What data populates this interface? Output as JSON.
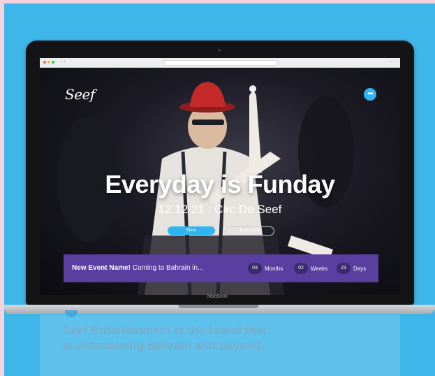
{
  "browser": {
    "controls": [
      "close-dot",
      "minimize-dot",
      "maximize-dot"
    ],
    "nav": "‹ ›",
    "tools": "⋯"
  },
  "site": {
    "logo": "Seef",
    "menu_icon": "•••",
    "hero_title": "Everyday is Funday",
    "hero_subtitle": "12.12.21 : Circ De Seef",
    "more_button": "More",
    "book_button": "Book Now!"
  },
  "event_bar": {
    "name": "New Event Name!",
    "tagline": " Coming to Bahrain in...",
    "countdown": [
      {
        "value": "03",
        "unit": "Months"
      },
      {
        "value": "02",
        "unit": "Weeks"
      },
      {
        "value": "23",
        "unit": "Days"
      }
    ]
  },
  "device": {
    "label": "MacBook"
  },
  "below": {
    "tagline": "Seef Entertainment is the brand that is entertaining Bahrain and beyond."
  },
  "colors": {
    "background": "#3fb6e9",
    "accent": "#2fb6f0",
    "event_bar": "#5a3ea0"
  }
}
